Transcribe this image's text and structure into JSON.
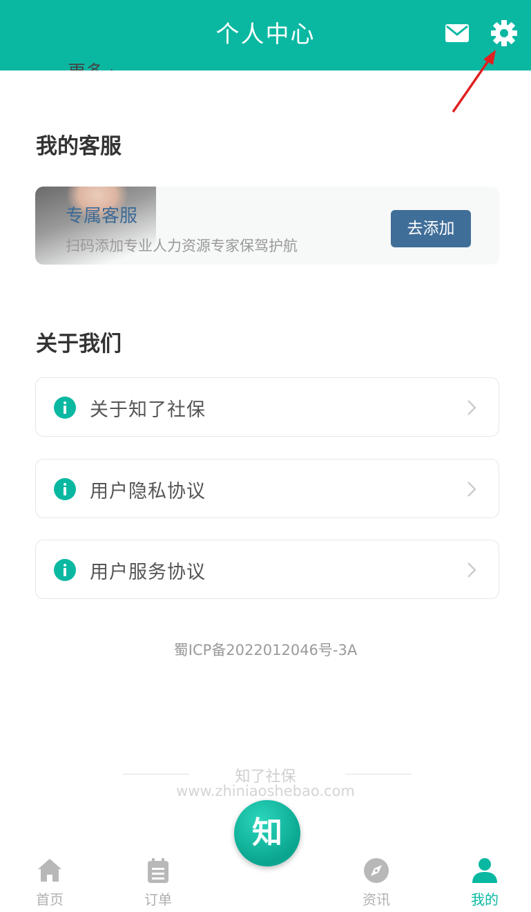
{
  "header": {
    "title": "个人中心"
  },
  "partial_row": {
    "label": "更多 ›"
  },
  "service_section": {
    "title": "我的客服",
    "card_title": "专属客服",
    "card_desc": "扫码添加专业人力资源专家保驾护航",
    "add_button": "去添加"
  },
  "about_section": {
    "title": "关于我们",
    "items": [
      {
        "label": "关于知了社保"
      },
      {
        "label": "用户隐私协议"
      },
      {
        "label": "用户服务协议"
      }
    ]
  },
  "footer": {
    "icp": "蜀ICP备2022012046号-3A",
    "brand_name": "知了社保",
    "brand_url": "www.zhiniaoshebao.com"
  },
  "tabbar": {
    "home": "首页",
    "orders": "订单",
    "center": "知",
    "news": "资讯",
    "mine": "我的"
  },
  "colors": {
    "accent": "#0ab8a2",
    "button": "#3f6e98",
    "annotation": "#e02020"
  },
  "icons": [
    "mail-icon",
    "gear-icon",
    "info-icon",
    "chevron-right-icon",
    "home-icon",
    "clipboard-icon",
    "compass-icon",
    "user-icon"
  ]
}
